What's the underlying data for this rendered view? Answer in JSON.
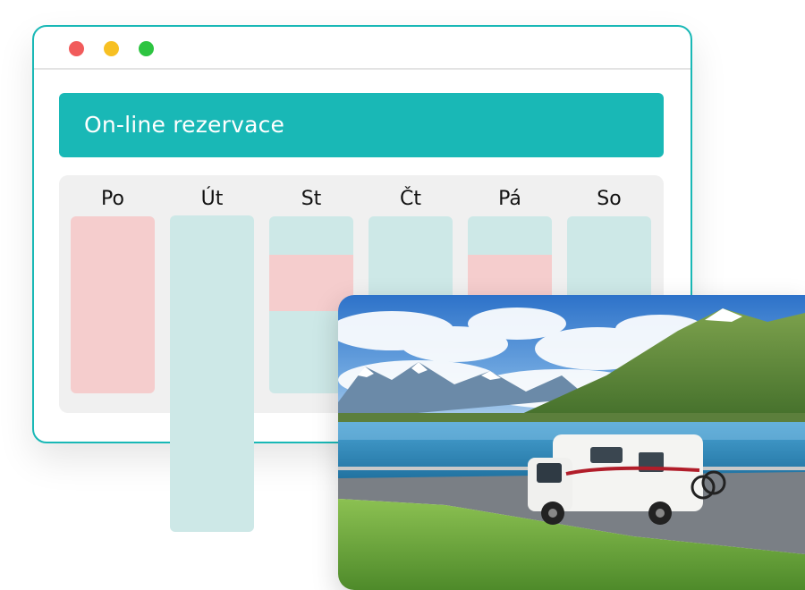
{
  "app": {
    "banner_title": "On-line rezervace"
  },
  "calendar": {
    "days": [
      {
        "label": "Po"
      },
      {
        "label": "Út"
      },
      {
        "label": "St"
      },
      {
        "label": "Čt"
      },
      {
        "label": "Pá"
      },
      {
        "label": "So"
      }
    ]
  },
  "colors": {
    "accent": "#19b8b6",
    "booked": "#f5cdcd",
    "available": "#cde8e7",
    "window_controls": [
      "#f15b5b",
      "#f7c023",
      "#2dc441"
    ]
  },
  "photo": {
    "subject": "camper-van-by-mountain-lake"
  }
}
